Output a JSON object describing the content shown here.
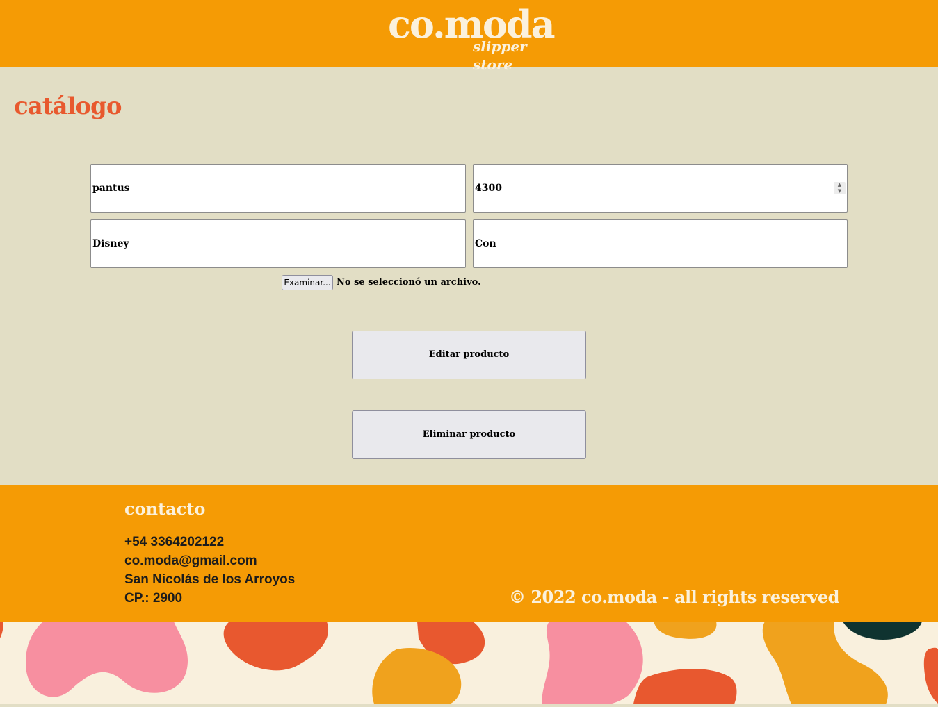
{
  "colors": {
    "brand_orange": "#f59b05",
    "background": "#e2dec5",
    "title_accent": "#e8592e",
    "cream": "#fbf1dc",
    "pattern_pink": "#f78fa0",
    "pattern_red": "#e8582f",
    "pattern_orange": "#f0a21d",
    "pattern_dark": "#0f3330"
  },
  "header": {
    "logo_main": "co.moda",
    "logo_sub": "slipper store"
  },
  "page": {
    "title": "catálogo"
  },
  "form": {
    "name_value": "pantus",
    "price_value": "4300",
    "brand_value": "Disney",
    "detail_value": "Con",
    "file_button_label": "Examinar...",
    "file_status": "No se seleccionó un archivo.",
    "edit_button_label": "Editar producto",
    "delete_button_label": "Eliminar producto",
    "spinner_up_icon": "chevron-up-icon",
    "spinner_down_icon": "chevron-down-icon"
  },
  "footer": {
    "contact_title": "contacto",
    "phone": "+54 3364202122",
    "email": "co.moda@gmail.com",
    "city": "San Nicolás de los Arroyos",
    "postal_code": "CP.: 2900",
    "copyright": "© 2022 co.moda - all rights reserved"
  }
}
